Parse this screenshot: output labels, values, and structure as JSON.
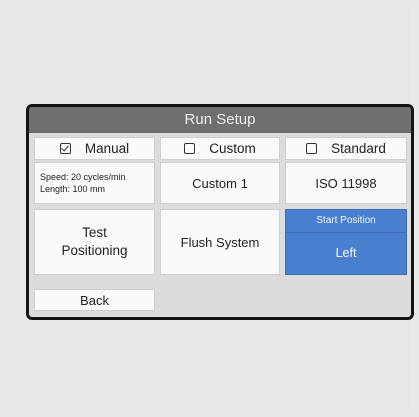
{
  "title": "Run Setup",
  "modes": [
    {
      "label": "Manual",
      "checked": true
    },
    {
      "label": "Custom",
      "checked": false
    },
    {
      "label": "Standard",
      "checked": false
    }
  ],
  "manual_info": {
    "speed": "Speed: 20 cycles/min",
    "length": "Length: 100 mm"
  },
  "custom_value": "Custom 1",
  "standard_value": "ISO 11998",
  "buttons": {
    "test_positioning_line1": "Test",
    "test_positioning_line2": "Positioning",
    "flush_system": "Flush System",
    "back": "Back"
  },
  "start_position": {
    "label": "Start Position",
    "value": "Left"
  },
  "colors": {
    "accent": "#4a7fcf",
    "title_bar": "#6f6f6f"
  }
}
